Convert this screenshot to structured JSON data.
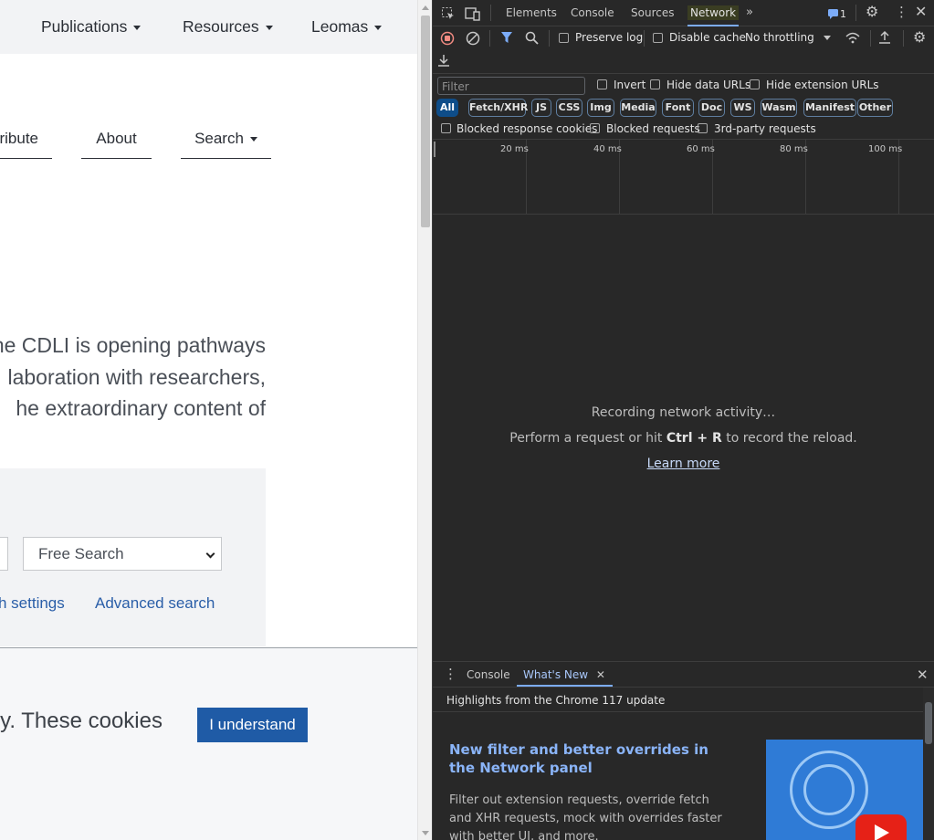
{
  "page": {
    "topnav": {
      "publications": "Publications",
      "resources": "Resources",
      "leomas": "Leomas"
    },
    "subnav": {
      "contribute": "ribute",
      "about": "About",
      "search": "Search"
    },
    "intro_lines": [
      "he CDLI is opening pathways",
      "laboration with researchers,",
      "he extraordinary content of"
    ],
    "search": {
      "select_value": "Free Search",
      "settings_link": "h settings",
      "advanced_link": "Advanced search"
    },
    "cookie": {
      "text": "rly. These cookies",
      "button": "I understand"
    }
  },
  "devtools": {
    "tabs": [
      "Elements",
      "Console",
      "Sources",
      "Network"
    ],
    "issues_count": "1",
    "toolbar": {
      "preserve_log": "Preserve log",
      "disable_cache": "Disable cache",
      "throttling": "No throttling"
    },
    "filter": {
      "placeholder": "Filter",
      "invert": "Invert",
      "hide_data_urls": "Hide data URLs",
      "hide_extension_urls": "Hide extension URLs",
      "types": [
        "All",
        "Fetch/XHR",
        "JS",
        "CSS",
        "Img",
        "Media",
        "Font",
        "Doc",
        "WS",
        "Wasm",
        "Manifest",
        "Other"
      ],
      "blocked_response_cookies": "Blocked response cookies",
      "blocked_requests": "Blocked requests",
      "third_party": "3rd-party requests"
    },
    "timeline_ticks": [
      "20 ms",
      "40 ms",
      "60 ms",
      "80 ms",
      "100 ms"
    ],
    "empty_state": {
      "recording": "Recording network activity…",
      "hint_pre": "Perform a request or hit ",
      "hint_keys": "Ctrl + R",
      "hint_post": " to record the reload.",
      "learn_more": "Learn more"
    },
    "drawer": {
      "console_tab": "Console",
      "whats_new_tab": "What's New",
      "highlights": "Highlights from the Chrome 117 update",
      "article_title": "New filter and better overrides in the Network panel",
      "article_desc": "Filter out extension requests, override fetch and XHR requests, mock with overrides faster with better UI, and more."
    },
    "colors": {
      "accent": "#7cacf8",
      "panel_bg": "#282828",
      "active_chip": "#0e4d89",
      "record_icon": "#f28b82"
    }
  }
}
